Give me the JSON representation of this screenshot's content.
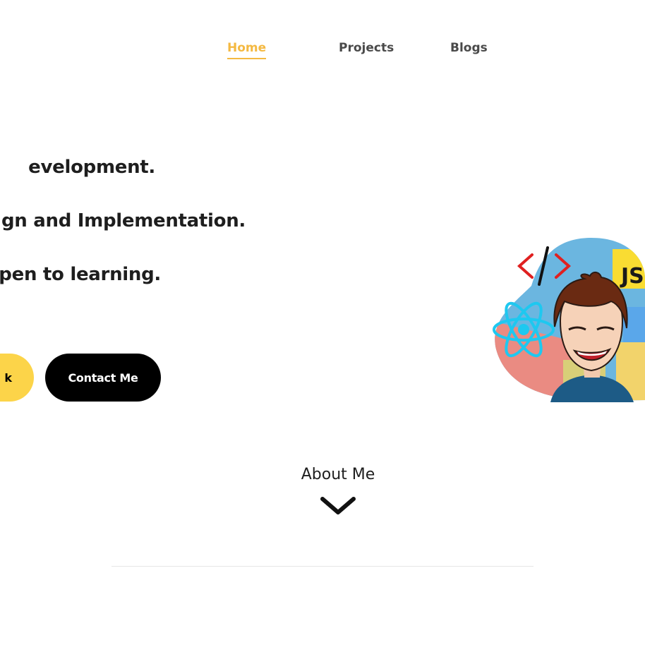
{
  "nav": {
    "items": [
      {
        "label": "Home",
        "active": true
      },
      {
        "label": "Projects",
        "active": false
      },
      {
        "label": "Blogs",
        "active": false
      }
    ],
    "active_color": "#f4b942"
  },
  "hero": {
    "lines": [
      "evelopment.",
      "gn and Implementation.",
      "open to learning."
    ],
    "work_button": "k",
    "contact_button": "Contact Me"
  },
  "about": {
    "label": "About Me"
  },
  "illustration": {
    "code_tag": "</>",
    "js_badge": "JS"
  },
  "colors": {
    "accent_yellow": "#fcd449",
    "dark": "#000000"
  }
}
